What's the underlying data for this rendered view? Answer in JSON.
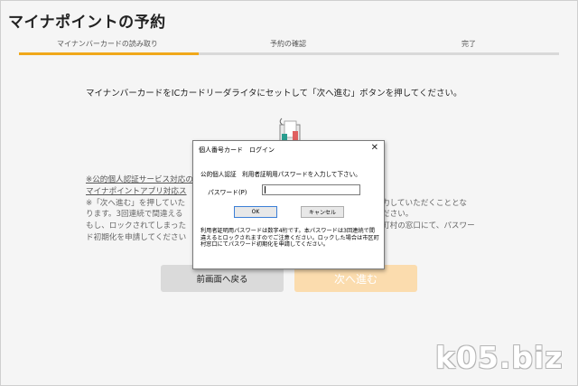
{
  "page": {
    "title": "マイナポイントの予約"
  },
  "steps": [
    {
      "label": "マイナンバーカードの読み取り",
      "active": true
    },
    {
      "label": "予約の確認",
      "active": false
    },
    {
      "label": "完了",
      "active": false
    }
  ],
  "instruction": "マイナンバーカードをICカードリーダライタにセットして「次へ進む」ボタンを押してください。",
  "icons": {
    "card_reader": "card-reader-icon",
    "close": "close-icon"
  },
  "notes": {
    "line1": "※公的個人認証サービス対応の",
    "line2": "マイナポイントアプリ対応ス",
    "line3": "※「次へ進む」を押していた",
    "line3_right": "力していただくこととな",
    "line4": "ります。3回連続で間違える",
    "line4_right": "ださい。",
    "line5": "もし、ロックされてしまった",
    "line5_right": "町村の窓口にて、パスワー",
    "line6": "ド初期化を申請してください"
  },
  "buttons": {
    "back": "前画面へ戻る",
    "next": "次へ進む"
  },
  "dialog": {
    "title": "個人番号カード　ログイン",
    "prompt": "公的個人認証　利用者証明用パスワードを入力して下さい。",
    "password_label": "パスワード(P)",
    "password_value": "",
    "ok": "OK",
    "cancel": "キャンセル",
    "note": "利用者証明用パスワードは数字4桁です。本パスワードは3回連続で間違えるとロックされますのでご注意ください。ロックした場合は市区町村窓口にてパスワード初期化を申請してください。"
  },
  "watermark": "k05.biz",
  "colors": {
    "accent": "#f0a81a",
    "next_button": "#fbdcae",
    "back_button": "#dadada"
  }
}
